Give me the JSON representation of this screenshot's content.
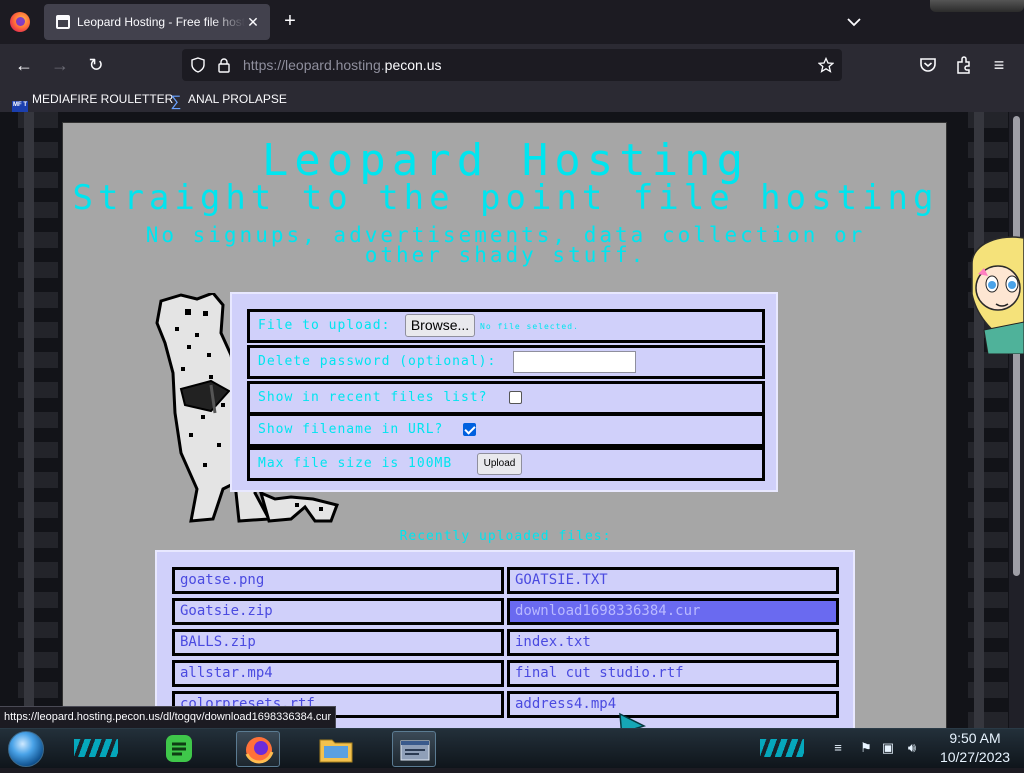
{
  "browser": {
    "tab_title": "Leopard Hosting - Free file hosting",
    "url_prefix": "https://leopard.hosting.",
    "url_domain": "pecon.us",
    "bookmarks": [
      "MEDIAFIRE ROULETTER",
      "ANAL PROLAPSE"
    ],
    "bookmark_icon_text": "MF T",
    "status_url": "https://leopard.hosting.pecon.us/dl/togqv/download1698336384.cur"
  },
  "page": {
    "title": "Leopard Hosting",
    "subtitle": "Straight to the point file hosting",
    "tagline": "No signups, advertisements, data collection or other shady stuff.",
    "form": {
      "file_label": "File to upload:",
      "browse_label": "Browse...",
      "no_file_text": "No file selected.",
      "password_label": "Delete password (optional):",
      "password_value": "",
      "recent_label": "Show in recent files list?",
      "recent_checked": false,
      "filename_label": "Show filename in URL?",
      "filename_checked": true,
      "max_size_label": "Max file size is 100MB",
      "upload_label": "Upload"
    },
    "recent_heading": "Recently uploaded files:",
    "files": [
      "goatse.png",
      "GOATSIE.TXT",
      "Goatsie.zip",
      "download1698336384.cur",
      "BALLS.zip",
      "index.txt",
      "allstar.mp4",
      "final cut studio.rtf",
      "colorpresets.rtf",
      "address4.mp4"
    ],
    "hovered_file": "download1698336384.cur"
  },
  "taskbar": {
    "time": "9:50 AM",
    "date": "10/27/2023"
  },
  "colors": {
    "accent_text": "#00e5ef",
    "panel": "#d0d0fa",
    "page_bg": "#a6a6a6",
    "link": "#4a4ae0",
    "hover": "#6a6af0"
  }
}
